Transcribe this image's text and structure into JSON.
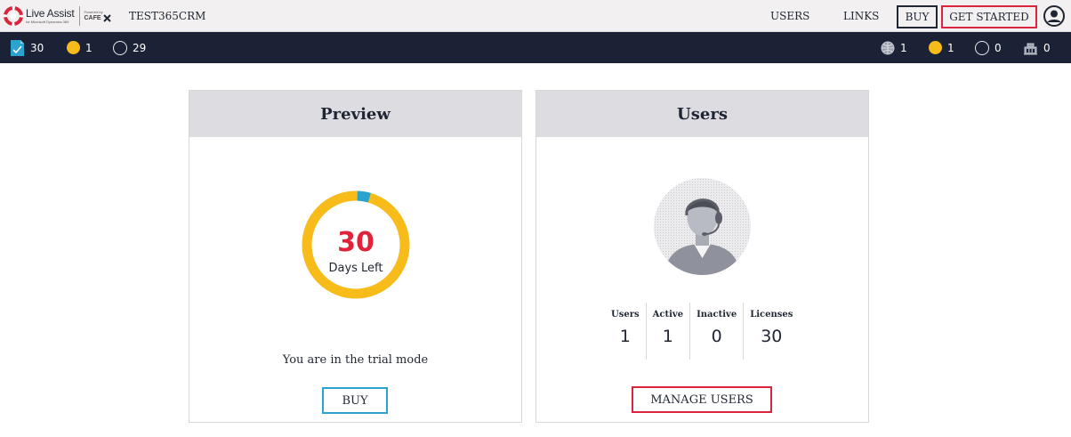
{
  "app": {
    "logo_name": "Live Assist",
    "logo_tagline": "for Microsoft Dynamics 365",
    "powered_by": "Powered by",
    "powered_brand": "CAFE",
    "org_name": "TEST365CRM"
  },
  "nav": {
    "users": "USERS",
    "links": "LINKS",
    "buy": "BUY",
    "get_started": "GET STARTED"
  },
  "status_left": {
    "licenses": "30",
    "yellow": "1",
    "empty": "29"
  },
  "status_right": {
    "agents": "1",
    "yellow": "1",
    "empty": "0",
    "queue": "0"
  },
  "preview": {
    "title": "Preview",
    "days": "30",
    "days_label": "Days Left",
    "days_left_fraction": 0.04,
    "message": "You are in the trial mode",
    "buy_label": "BUY"
  },
  "users": {
    "title": "Users",
    "stats": [
      {
        "label": "Users",
        "value": "1"
      },
      {
        "label": "Active",
        "value": "1"
      },
      {
        "label": "Inactive",
        "value": "0"
      },
      {
        "label": "Licenses",
        "value": "30"
      }
    ],
    "manage_label": "MANAGE USERS"
  },
  "colors": {
    "brand_red": "#d9263c",
    "accent_yellow": "#f7bb1a",
    "accent_blue": "#2aa3cf",
    "navy": "#1c2236"
  }
}
